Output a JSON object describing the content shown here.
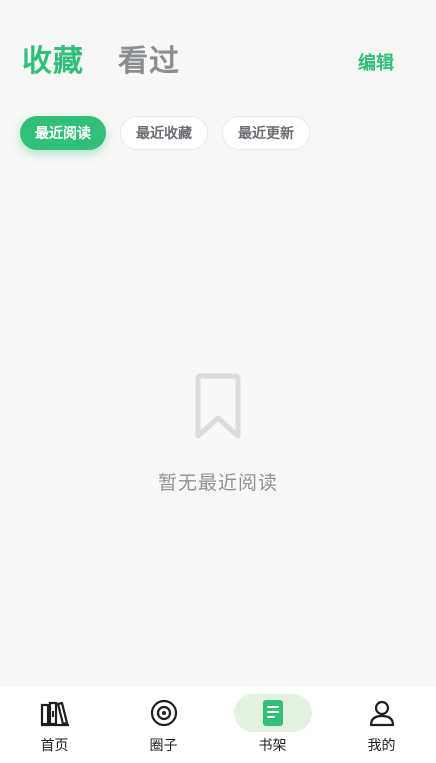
{
  "header": {
    "tabs": [
      {
        "label": "收藏",
        "active": true
      },
      {
        "label": "看过",
        "active": false
      }
    ],
    "edit_label": "编辑"
  },
  "filters": [
    {
      "label": "最近阅读",
      "active": true
    },
    {
      "label": "最近收藏",
      "active": false
    },
    {
      "label": "最近更新",
      "active": false
    }
  ],
  "empty_state": {
    "icon": "bookmark-icon",
    "text": "暂无最近阅读"
  },
  "bottom_nav": [
    {
      "label": "首页",
      "icon": "books-icon",
      "active": false
    },
    {
      "label": "圈子",
      "icon": "circle-target-icon",
      "active": false
    },
    {
      "label": "书架",
      "icon": "bookshelf-icon",
      "active": true
    },
    {
      "label": "我的",
      "icon": "user-icon",
      "active": false
    }
  ],
  "colors": {
    "accent": "#31bf79",
    "background": "#f7f7f5",
    "muted_text": "#8a8d93",
    "nav_active_bg": "#e3f1df"
  }
}
